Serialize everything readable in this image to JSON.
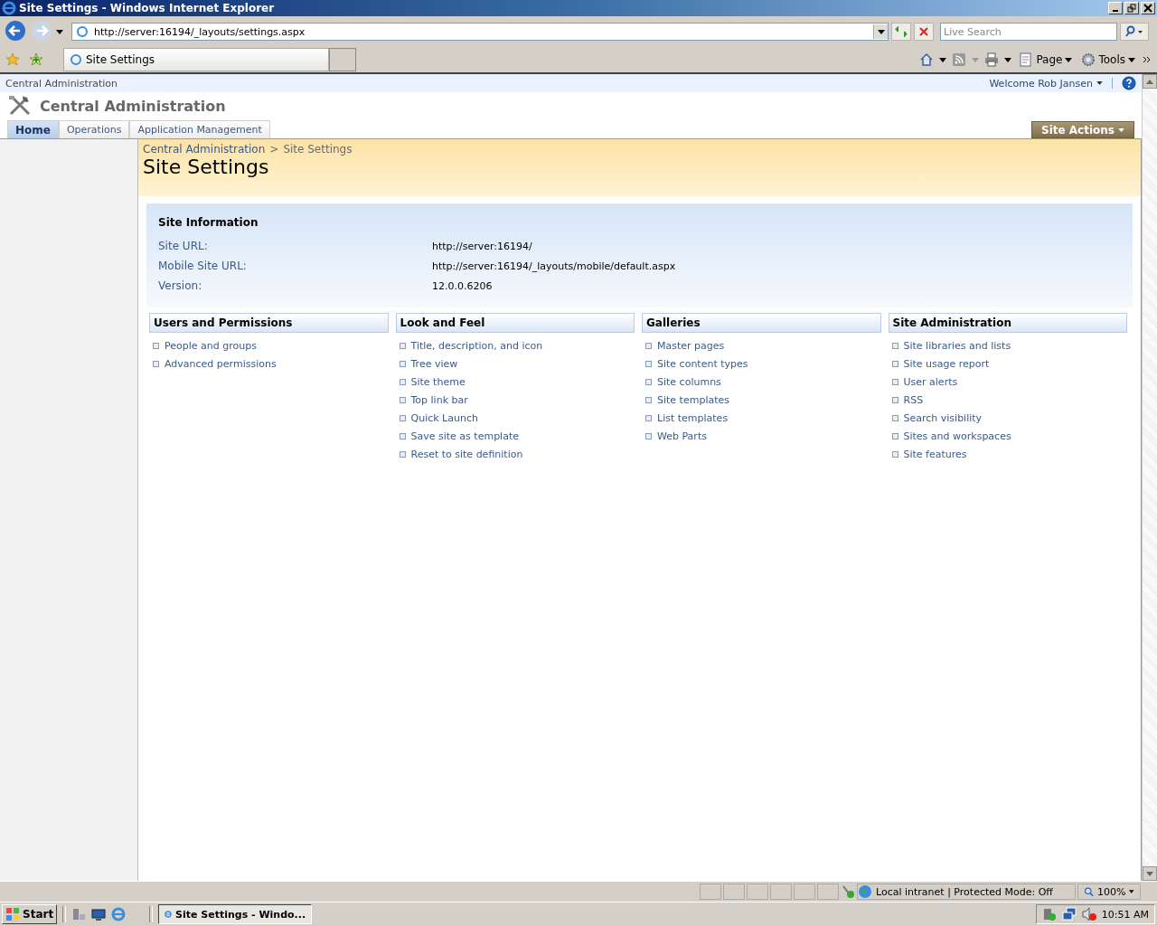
{
  "window": {
    "title": "Site Settings - Windows Internet Explorer",
    "address": "http://server:16194/_layouts/settings.aspx",
    "search": {
      "placeholder": "Live Search"
    }
  },
  "browser_tabs": [
    {
      "label": "Site Settings",
      "selected": true
    }
  ],
  "command_bar": [
    "Page",
    "Tools"
  ],
  "top_bar": {
    "site": "Central Administration",
    "welcome": "Welcome Rob Jansen"
  },
  "site_title": "Central Administration",
  "nav_tabs": [
    {
      "label": "Home",
      "selected": true
    },
    {
      "label": "Operations",
      "selected": false
    },
    {
      "label": "Application Management",
      "selected": false
    }
  ],
  "site_actions": "Site Actions",
  "breadcrumb": {
    "link": "Central Administration",
    "separator": ">",
    "current": "Site Settings"
  },
  "page_title": "Site Settings",
  "site_information": {
    "heading": "Site Information",
    "rows": [
      {
        "label": "Site URL:",
        "value": "http://server:16194/"
      },
      {
        "label": "Mobile Site URL:",
        "value": "http://server:16194/_layouts/mobile/default.aspx"
      },
      {
        "label": "Version:",
        "value": "12.0.0.6206"
      }
    ]
  },
  "sections": [
    {
      "heading": "Users and Permissions",
      "links": [
        "People and groups",
        "Advanced permissions"
      ]
    },
    {
      "heading": "Look and Feel",
      "links": [
        "Title, description, and icon",
        "Tree view",
        "Site theme",
        "Top link bar",
        "Quick Launch",
        "Save site as template",
        "Reset to site definition"
      ]
    },
    {
      "heading": "Galleries",
      "links": [
        "Master pages",
        "Site content types",
        "Site columns",
        "Site templates",
        "List templates",
        "Web Parts"
      ]
    },
    {
      "heading": "Site Administration",
      "links": [
        "Site libraries and lists",
        "Site usage report",
        "User alerts",
        "RSS",
        "Search visibility",
        "Sites and workspaces",
        "Site features"
      ]
    }
  ],
  "status_bar": {
    "zone": "Local intranet | Protected Mode: Off",
    "zoom": "100%"
  },
  "taskbar": {
    "start": "Start",
    "task": "Site Settings - Windo...",
    "clock": "10:51 AM"
  }
}
